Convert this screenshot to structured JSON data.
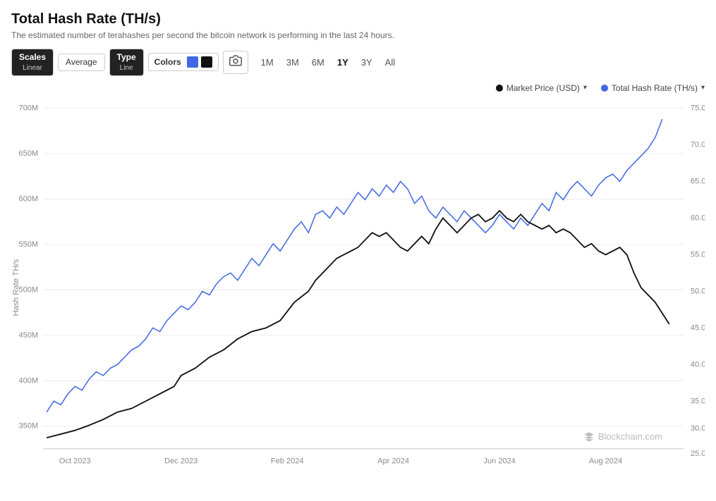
{
  "title": "Total Hash Rate (TH/s)",
  "subtitle": "The estimated number of terahashes per second the bitcoin network is performing in the last 24 hours.",
  "toolbar": {
    "scales_label": "Scales",
    "scales_value": "Linear",
    "average_label": "Average",
    "type_label": "Type",
    "type_value": "Line",
    "colors_label": "Colors",
    "camera_icon": "📷"
  },
  "time_periods": [
    "1M",
    "3M",
    "6M",
    "1Y",
    "3Y",
    "All"
  ],
  "active_period": "1Y",
  "legend": {
    "market_price_label": "Market Price (USD)",
    "hash_rate_label": "Total Hash Rate (TH/s)"
  },
  "y_axis_left": [
    "700M",
    "650M",
    "600M",
    "550M",
    "500M",
    "450M",
    "400M",
    "350M"
  ],
  "y_axis_right": [
    "75.0K",
    "70.0K",
    "65.0K",
    "60.0K",
    "55.0K",
    "50.0K",
    "45.0K",
    "40.0K",
    "35.0K",
    "30.0K",
    "25.0K"
  ],
  "x_axis": [
    "Oct 2023",
    "Dec 2023",
    "Feb 2024",
    "Apr 2024",
    "Jun 2024",
    "Aug 2024"
  ],
  "y_label": "Hash Rate TH/s",
  "watermark": "Blockchain.com",
  "colors": {
    "blue": "#4169e1",
    "black": "#111111",
    "accent": "#4169e1"
  }
}
